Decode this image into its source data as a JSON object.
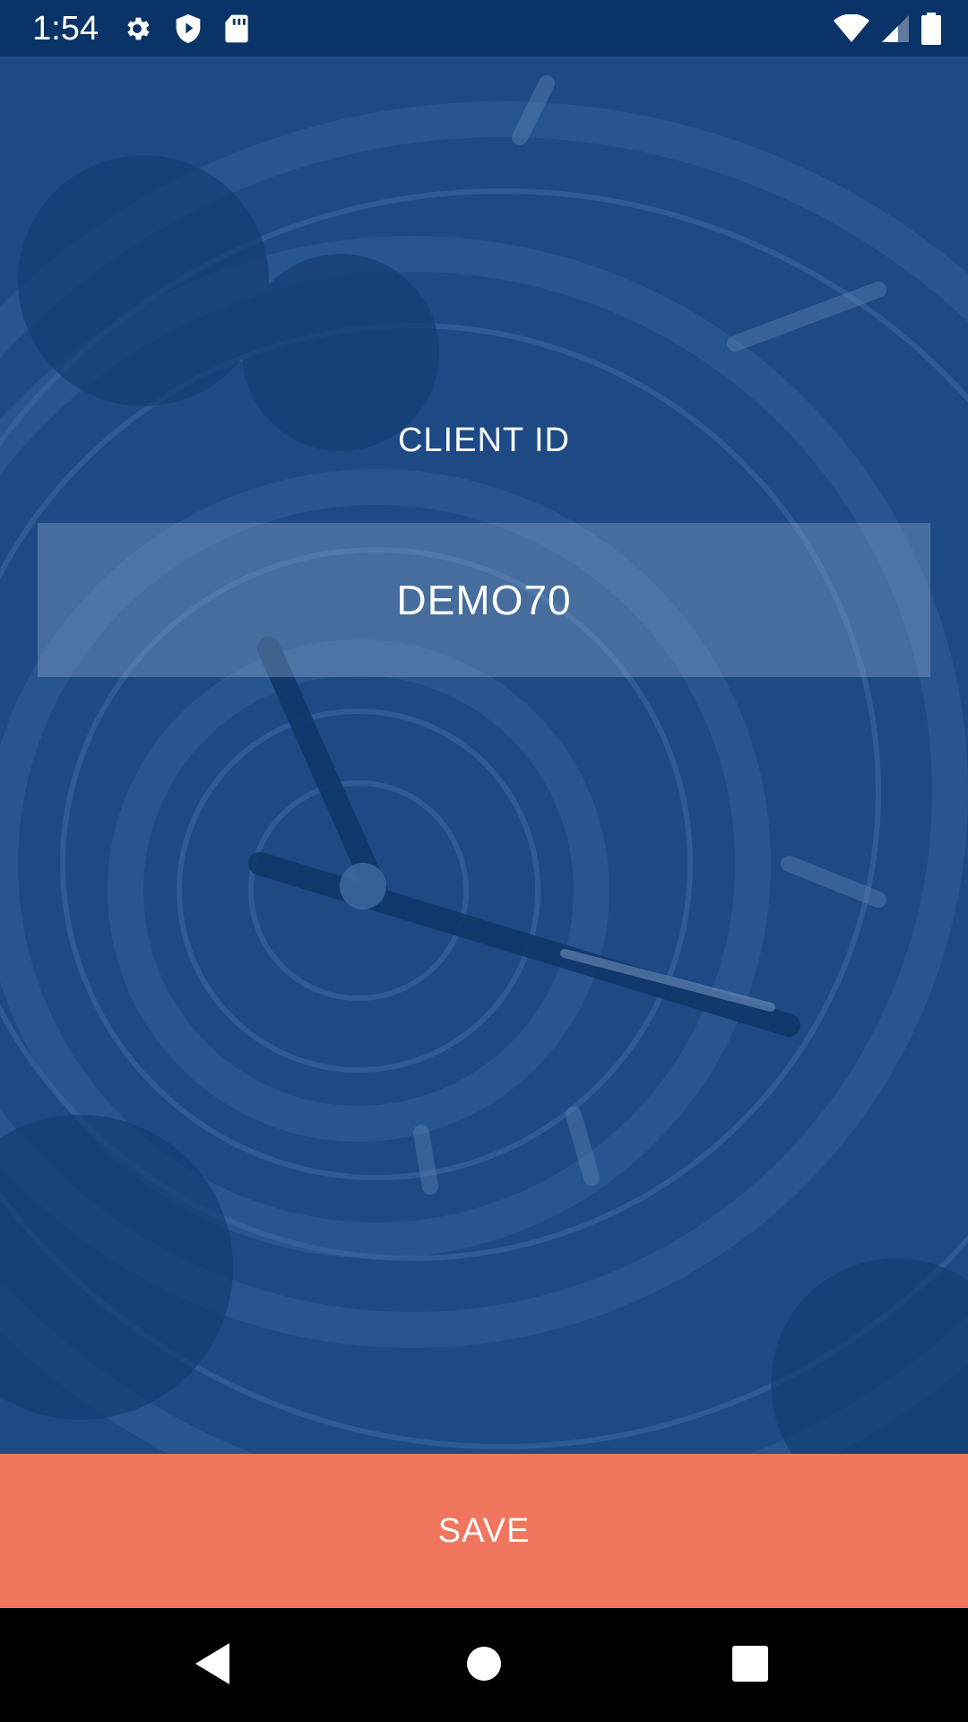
{
  "status_bar": {
    "time": "1:54",
    "left_icons": [
      "gear-icon",
      "shield-icon",
      "sd-card-icon"
    ],
    "right_icons": [
      "wifi-icon",
      "cell-signal-icon",
      "battery-icon"
    ]
  },
  "form": {
    "label": "CLIENT ID",
    "value": "DEMO70"
  },
  "actions": {
    "save_label": "SAVE"
  },
  "nav_bar": {
    "buttons": [
      "back-icon",
      "home-icon",
      "recents-icon"
    ]
  },
  "colors": {
    "status_bar": "#0a3468",
    "background": "#1d4a85",
    "save_button": "#f0765e",
    "nav_bar": "#000000"
  }
}
